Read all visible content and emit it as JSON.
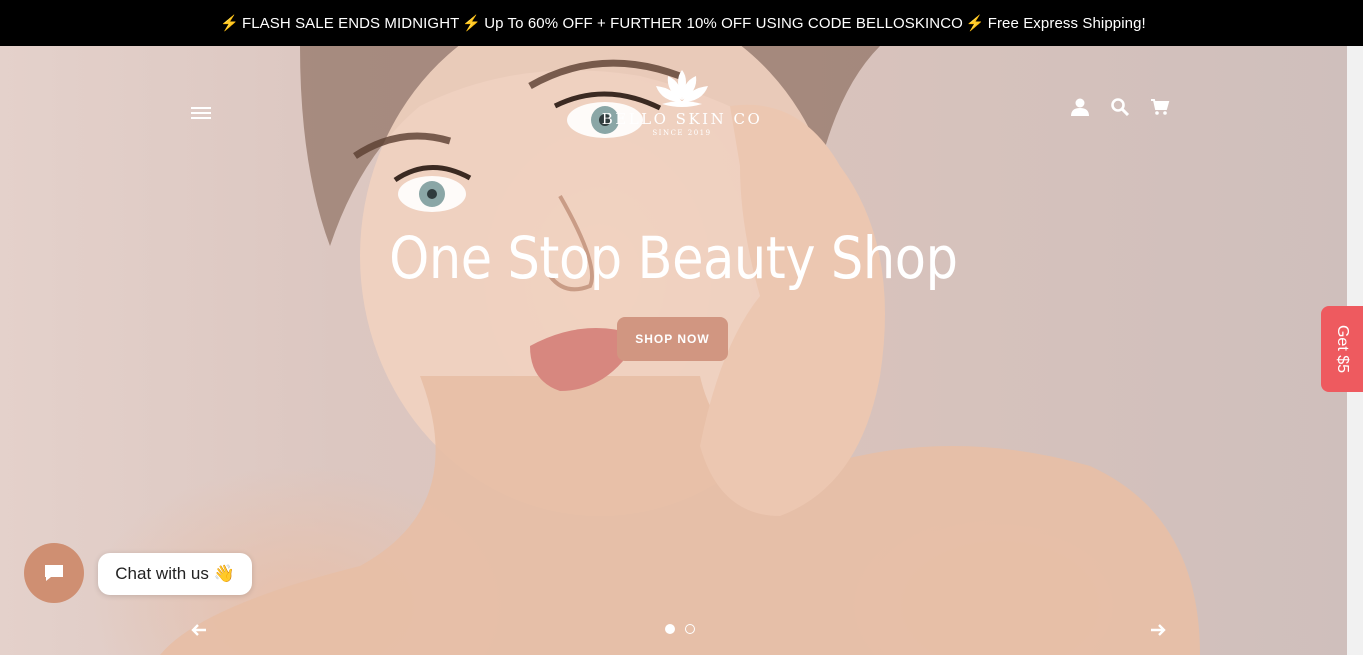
{
  "announcement": {
    "bolt_icon": "⚡",
    "part1": "FLASH SALE ENDS MIDNIGHT",
    "part2": "Up To 60% OFF + FURTHER 10% OFF USING CODE BELLOSKINCO",
    "part3": "Free Express Shipping!",
    "background": "#000000"
  },
  "header": {
    "menu_icon": "hamburger-menu-icon",
    "logo": {
      "brand": "BELLO SKIN CO",
      "since": "SINCE 2019"
    },
    "icons": [
      "account-icon",
      "search-icon",
      "cart-icon"
    ]
  },
  "hero": {
    "headline": "One Stop Beauty Shop",
    "cta_label": "SHOP NOW",
    "cta_color": "#d19681",
    "slides_total": 2,
    "slide_active": 1
  },
  "side_tab": {
    "label": "Get $5",
    "color": "#ee5a5f"
  },
  "chat": {
    "label": "Chat with us 👋",
    "button_color": "#cf8f72"
  }
}
